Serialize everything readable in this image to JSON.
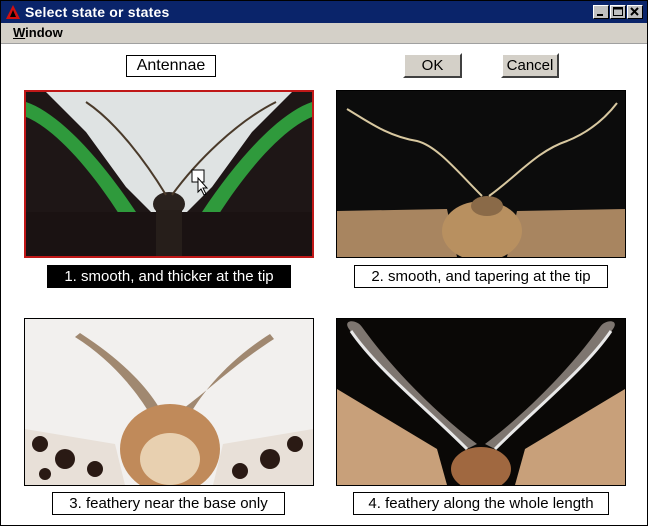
{
  "window": {
    "title": "Select state or states",
    "controls": [
      "minimize-icon",
      "maximize-icon",
      "close-icon"
    ]
  },
  "menu": {
    "window_label": "Window"
  },
  "heading": "Antennae",
  "buttons": {
    "ok_label": "OK",
    "cancel_label": "Cancel"
  },
  "states": [
    {
      "label": "1. smooth, and thicker at the tip",
      "selected": true
    },
    {
      "label": "2. smooth, and tapering at the tip",
      "selected": false
    },
    {
      "label": "3. feathery near the base only",
      "selected": false
    },
    {
      "label": "4. feathery along the whole length",
      "selected": false
    }
  ],
  "colors": {
    "titlebar": "#0a246a",
    "selection_border": "#c01818",
    "dialog_face": "#d4d0c8"
  }
}
